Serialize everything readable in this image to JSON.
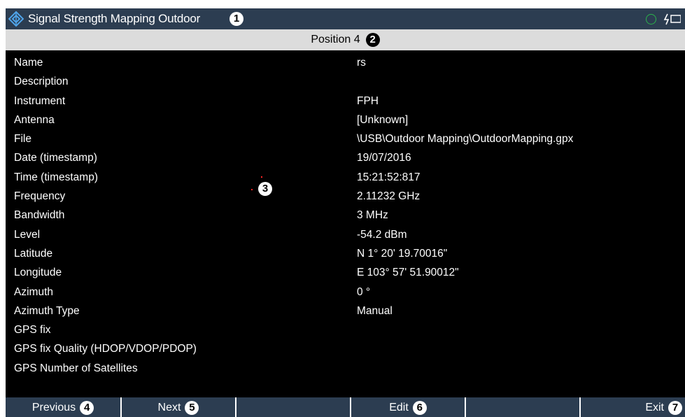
{
  "window": {
    "title": "Signal Strength Mapping Outdoor",
    "title_callout": "1"
  },
  "status": {
    "icons": [
      "gps-status-circle-icon",
      "power-battery-icon"
    ],
    "gps_color": "#2bb24c"
  },
  "subheader": {
    "label": "Position 4",
    "callout": "2"
  },
  "details": {
    "rows": [
      {
        "key": "Name",
        "value": "rs"
      },
      {
        "key": "Description",
        "value": ""
      },
      {
        "key": "Instrument",
        "value": "FPH"
      },
      {
        "key": "Antenna",
        "value": "[Unknown]"
      },
      {
        "key": "File",
        "value": "\\USB\\Outdoor Mapping\\OutdoorMapping.gpx"
      },
      {
        "key": "Date (timestamp)",
        "value": "19/07/2016"
      },
      {
        "key": "Time (timestamp)",
        "value": "15:21:52:817"
      },
      {
        "key": "Frequency",
        "value": "2.11232 GHz"
      },
      {
        "key": "Bandwidth",
        "value": "3 MHz"
      },
      {
        "key": "Level",
        "value": "-54.2 dBm"
      },
      {
        "key": "Latitude",
        "value": "N 1° 20' 19.70016\""
      },
      {
        "key": "Longitude",
        "value": "E 103° 57' 51.90012\""
      },
      {
        "key": "Azimuth",
        "value": "0 °"
      },
      {
        "key": "Azimuth Type",
        "value": "Manual"
      },
      {
        "key": "GPS fix",
        "value": ""
      },
      {
        "key": "GPS fix Quality (HDOP/VDOP/PDOP)",
        "value": ""
      },
      {
        "key": "GPS Number of Satellites",
        "value": ""
      }
    ],
    "table_callout": "3"
  },
  "softkeys": {
    "previous": {
      "label": "Previous",
      "callout": "4"
    },
    "next": {
      "label": "Next",
      "callout": "5"
    },
    "blank1": {
      "label": ""
    },
    "edit": {
      "label": "Edit",
      "callout": "6"
    },
    "blank2": {
      "label": ""
    },
    "exit": {
      "label": "Exit",
      "callout": "7"
    }
  },
  "colors": {
    "titlebar_bg": "#2c3d51",
    "subheader_bg": "#dcdcdc",
    "content_bg": "#000000",
    "softkey_bg": "#2c3d51",
    "marker_dot": "#ff2222"
  }
}
